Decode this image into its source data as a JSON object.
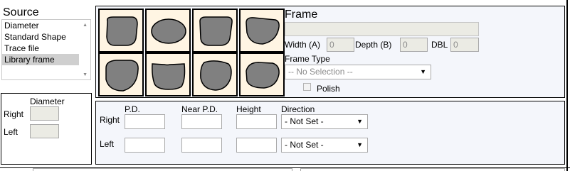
{
  "source": {
    "title": "Source",
    "options": [
      {
        "label": "Diameter",
        "selected": false
      },
      {
        "label": "Standard Shape",
        "selected": false
      },
      {
        "label": "Trace file",
        "selected": false
      },
      {
        "label": "Library frame",
        "selected": true
      }
    ]
  },
  "diameter": {
    "header": "Diameter",
    "right_label": "Right",
    "left_label": "Left",
    "right_value": "",
    "left_value": ""
  },
  "frame": {
    "title": "Frame",
    "name_value": "",
    "width_label": "Width (A)",
    "width_value": "0",
    "depth_label": "Depth (B)",
    "depth_value": "0",
    "dbl_label": "DBL",
    "dbl_value": "0",
    "frame_type_label": "Frame Type",
    "frame_type_value": "-- No Selection --",
    "polish_label": "Polish",
    "polish_checked": false
  },
  "shapes": [
    {
      "name": "shape-1"
    },
    {
      "name": "shape-2"
    },
    {
      "name": "shape-3"
    },
    {
      "name": "shape-4"
    },
    {
      "name": "shape-5"
    },
    {
      "name": "shape-6"
    },
    {
      "name": "shape-7"
    },
    {
      "name": "shape-8"
    }
  ],
  "measurements": {
    "pd_header": "P.D.",
    "near_pd_header": "Near P.D.",
    "height_header": "Height",
    "direction_header": "Direction",
    "right_label": "Right",
    "left_label": "Left",
    "right": {
      "pd": "",
      "near_pd": "",
      "height": "",
      "direction": "- Not Set -"
    },
    "left": {
      "pd": "",
      "near_pd": "",
      "height": "",
      "direction": "- Not Set -"
    }
  },
  "colors": {
    "shape_fill": "#808080",
    "shape_cell_bg": "#fff5e3",
    "panel_bg": "#f4f6fb",
    "selected_bg": "#cfcfcf"
  }
}
